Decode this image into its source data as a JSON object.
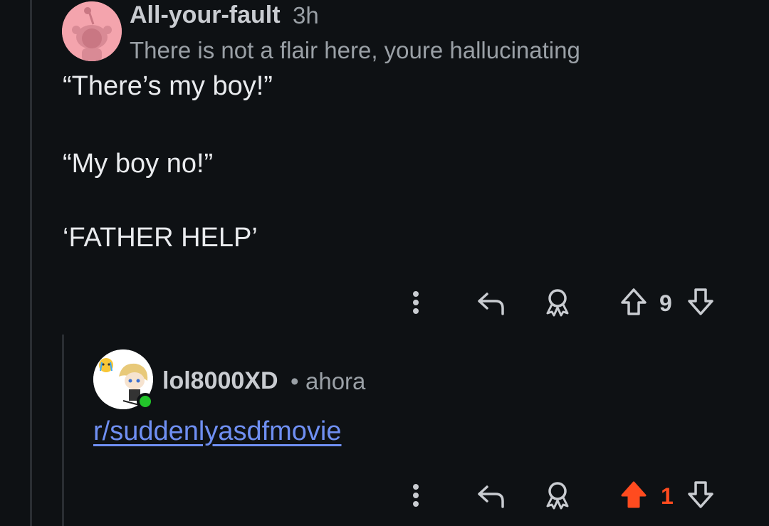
{
  "comment1": {
    "author": "All-your-fault",
    "time": "3h",
    "flair": "There is not a flair here, youre hallucinating",
    "body": [
      "“There’s my boy!”",
      "“My boy no!”",
      "‘FATHER HELP’"
    ],
    "score": "9",
    "upvoted": false
  },
  "comment2": {
    "author": "lol8000XD",
    "separator": "•",
    "time": "ahora",
    "link": "r/suddenlyasdfmovie",
    "score": "1",
    "upvoted": true
  },
  "colors": {
    "background": "#0e1114",
    "upvote_active": "#ff4b1f",
    "link": "#6f8ff2",
    "online": "#22c52a"
  },
  "icons": [
    "more-vertical-icon",
    "reply-icon",
    "award-icon",
    "upvote-icon",
    "downvote-icon"
  ]
}
